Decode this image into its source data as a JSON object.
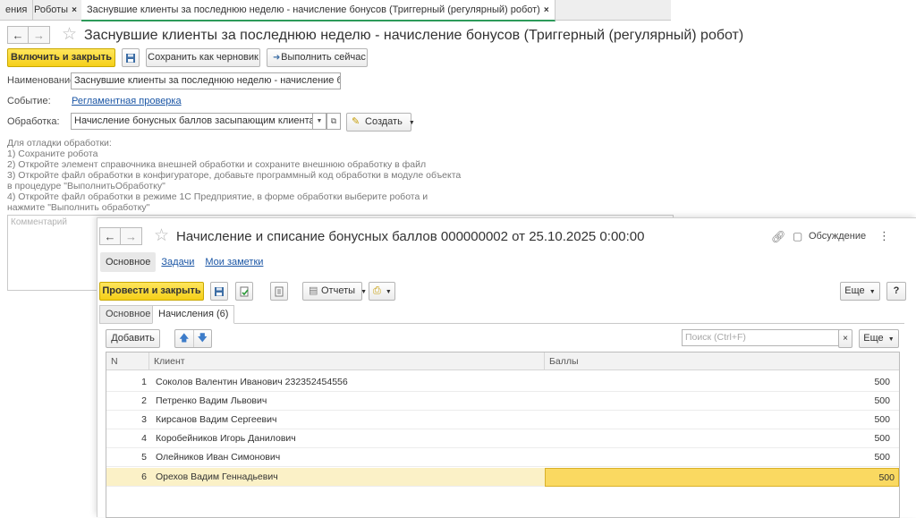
{
  "tabs": [
    {
      "label": "ения",
      "closable": false
    },
    {
      "label": "Роботы",
      "closable": true
    },
    {
      "label": "Заснувшие клиенты за последнюю неделю - начисление бонусов (Триггерный (регулярный) робот)",
      "closable": true,
      "active": true
    }
  ],
  "close_glyph": "×",
  "robot_form": {
    "title": "Заснувшие клиенты за последнюю неделю - начисление бонусов (Триггерный (регулярный) робот)",
    "buttons": {
      "enable_close": "Включить и закрыть",
      "save_draft": "Сохранить как черновик",
      "run_now": "Выполнить сейчас"
    },
    "name_label": "Наименование:",
    "name_value": "Заснувшие клиенты за последнюю неделю - начисление бонусов",
    "event_label": "Событие:",
    "event_value": "Регламентная проверка",
    "processing_label": "Обработка:",
    "processing_value": "Начисление бонусных баллов засыпающим клиентам",
    "create_label": "Создать",
    "instructions": [
      "Для отладки обработки:",
      "1) Сохраните робота",
      "2) Откройте элемент справочника внешней обработки и сохраните внешнюю обработку в файл",
      "3) Откройте файл обработки в конфигураторе, добавьте программный код обработки в модуле объекта",
      "в процедуре \"ВыполнитьОбработку\"",
      "4) Откройте файл обработки в режиме 1С Предприятие, в форме обработки выберите робота и",
      "нажмите \"Выполнить обработку\""
    ],
    "comment_placeholder": "Комментарий"
  },
  "doc_form": {
    "title": "Начисление и списание бонусных баллов 000000002 от 25.10.2025 0:00:00",
    "discussion_label": "Обсуждение",
    "section_tabs": [
      "Основное",
      "Задачи",
      "Мои заметки"
    ],
    "post_close_label": "Провести и закрыть",
    "reports_label": "Отчеты",
    "more_label": "Еще",
    "help_label": "?",
    "page_tabs": [
      "Основное",
      "Начисления (6)"
    ],
    "add_label": "Добавить",
    "search_placeholder": "Поиск (Ctrl+F)",
    "table": {
      "columns": [
        "N",
        "Клиент",
        "Баллы"
      ],
      "rows": [
        {
          "n": "1",
          "client": "Соколов Валентин Иванович 232352454556",
          "points": "500"
        },
        {
          "n": "2",
          "client": "Петренко Вадим Львович",
          "points": "500"
        },
        {
          "n": "3",
          "client": "Кирсанов Вадим Сергеевич",
          "points": "500"
        },
        {
          "n": "4",
          "client": "Коробейников Игорь Данилович",
          "points": "500"
        },
        {
          "n": "5",
          "client": "Олейников Иван Симонович",
          "points": "500"
        },
        {
          "n": "6",
          "client": "Орехов Вадим Геннадьевич",
          "points": "500"
        }
      ],
      "selected_row": 6
    }
  },
  "colors": {
    "accent_yellow": "#f5cf18",
    "link_blue": "#1b56a5",
    "active_tab_green": "#2d9b5a",
    "selected_row": "#fbf1c7",
    "selected_cell": "#fad961"
  }
}
